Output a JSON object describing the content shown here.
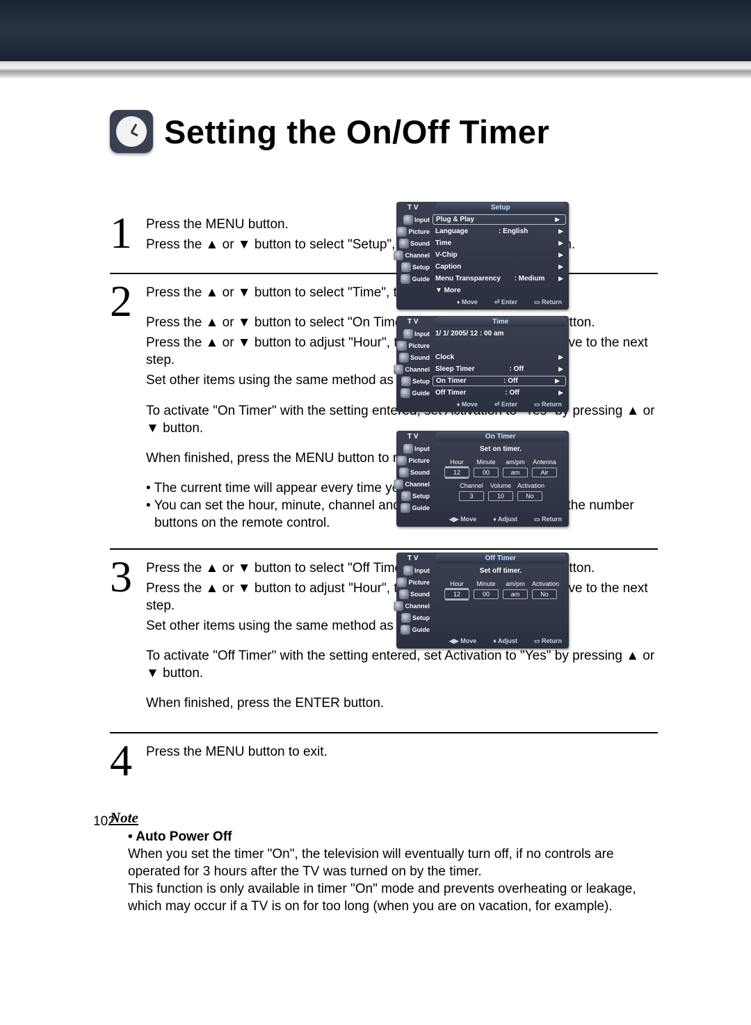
{
  "title": "Setting the On/Off Timer",
  "page_number": "102",
  "steps": [
    {
      "num": "1",
      "paras": [
        "Press the MENU button.",
        "Press the ▲ or ▼ button to select \"Setup\", then press the ENTER button."
      ]
    },
    {
      "num": "2",
      "paras": [
        "Press the ▲ or ▼ button to select \"Time\", then press the ENTER button.",
        "",
        "Press the ▲ or ▼ button to select \"On Timer\", then press the ENTER button.",
        "Press the ▲ or ▼ button to adjust \"Hour\", then press the ▶ button to move to the next step.",
        "Set other items using the same method as above.",
        "",
        "To activate \"On Timer\" with the setting entered, set Activation to \"Yes\" by pressing ▲ or ▼ button.",
        "",
        "When finished, press the MENU button to return."
      ],
      "bullets": [
        "The current time will appear every time you press the INFO button.",
        "You can set the hour, minute, channel and volume directly by pressing the number buttons on the remote control."
      ]
    },
    {
      "num": "3",
      "paras": [
        "Press the ▲ or ▼ button to select \"Off Timer\", then press the ENTER button.",
        "Press the ▲ or ▼ button to adjust \"Hour\", then press the ▶ button to move to the next step.",
        "Set other items using the same method as above.",
        "",
        "To activate \"Off Timer\" with the setting entered, set Activation to \"Yes\" by pressing ▲ or ▼ button.",
        "",
        "When finished, press the ENTER button."
      ]
    },
    {
      "num": "4",
      "paras": [
        "Press the MENU button to exit."
      ]
    }
  ],
  "note": {
    "label": "Note",
    "heading": "• Auto Power Off",
    "body1": "When you set the timer \"On\", the television will eventually turn off, if no controls are operated for 3 hours after the TV was turned on by the timer.",
    "body2": "This function is only available in timer \"On\" mode and prevents overheating or leakage, which may occur if a TV is on for too long (when you are on vacation, for example)."
  },
  "osd_sidebar": [
    "Input",
    "Picture",
    "Sound",
    "Channel",
    "Setup",
    "Guide"
  ],
  "osd": {
    "tv": "T V",
    "footer_move": "Move",
    "footer_enter": "Enter",
    "footer_return": "Return",
    "footer_adjust": "Adjust",
    "setup": {
      "title": "Setup",
      "items": [
        {
          "lbl": "Plug & Play",
          "val": ""
        },
        {
          "lbl": "Language",
          "val": ": English"
        },
        {
          "lbl": "Time",
          "val": ""
        },
        {
          "lbl": "V-Chip",
          "val": ""
        },
        {
          "lbl": "Caption",
          "val": ""
        },
        {
          "lbl": "Menu Transparency",
          "val": ": Medium"
        },
        {
          "lbl": "▼ More",
          "val": ""
        }
      ]
    },
    "time": {
      "title": "Time",
      "now": "1/ 1/ 2005/ 12 : 00  am",
      "items": [
        {
          "lbl": "Clock",
          "val": ""
        },
        {
          "lbl": "Sleep Timer",
          "val": ": Off"
        },
        {
          "lbl": "On Timer",
          "val": ": Off",
          "sel": true
        },
        {
          "lbl": "Off Timer",
          "val": ": Off"
        }
      ]
    },
    "on_timer": {
      "title": "On Timer",
      "subtitle": "Set on timer.",
      "hdr1": [
        "Hour",
        "Minute",
        "am/pm",
        "Antenna"
      ],
      "row1": [
        "12",
        "00",
        "am",
        "Air"
      ],
      "hdr2": [
        "Channel",
        "Volume",
        "Activation"
      ],
      "row2": [
        "3",
        "10",
        "No"
      ]
    },
    "off_timer": {
      "title": "Off Timer",
      "subtitle": "Set off timer.",
      "hdr1": [
        "Hour",
        "Minute",
        "am/pm",
        "Activation"
      ],
      "row1": [
        "12",
        "00",
        "am",
        "No"
      ]
    }
  }
}
